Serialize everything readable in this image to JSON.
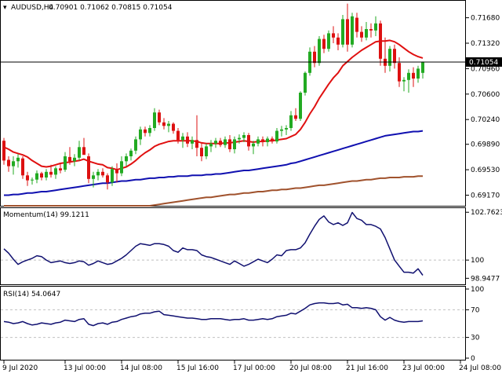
{
  "header": {
    "main_title": "AUDUSD,H4",
    "ohlc": "0.70901 0.71062 0.70815 0.71054",
    "momentum_title": "Momentum(14) 99.1211",
    "rsi_title": "RSI(14) 54.0647"
  },
  "colors": {
    "bull": "#22aa22",
    "bear": "#dd1111",
    "ma_fast": "#e01010",
    "ma_mid": "#1010b0",
    "ma_slow": "#a0522d",
    "oscillator": "#101070",
    "grid": "#c0c0c0",
    "current_price_bg": "#000000"
  },
  "chart_data": [
    {
      "type": "candlestick",
      "title": "AUDUSD,H4",
      "ylim": [
        0.6902,
        0.7192
      ],
      "y_ticks": [
        "0.71680",
        "0.71320",
        "0.70960",
        "0.70600",
        "0.70240",
        "0.69890",
        "0.69530",
        "0.69170"
      ],
      "y_tick_values": [
        0.7168,
        0.7132,
        0.7096,
        0.706,
        0.7024,
        0.6989,
        0.6953,
        0.6917
      ],
      "current_price": "0.71054",
      "current_price_value": 0.71054,
      "x_ticks": [
        "9 Jul 2020",
        "13 Jul 00:00",
        "14 Jul 08:00",
        "15 Jul 16:00",
        "17 Jul 00:00",
        "20 Jul 08:00",
        "21 Jul 16:00",
        "23 Jul 00:00",
        "24 Jul 08:00"
      ],
      "x_tick_bars": [
        0,
        13,
        25,
        37,
        49,
        61,
        73,
        85,
        97
      ],
      "candles": [
        [
          0.6994,
          0.6998,
          0.696,
          0.6966
        ],
        [
          0.6967,
          0.6972,
          0.695,
          0.6958
        ],
        [
          0.6958,
          0.6972,
          0.6946,
          0.6965
        ],
        [
          0.6965,
          0.6975,
          0.6956,
          0.697
        ],
        [
          0.6969,
          0.6972,
          0.694,
          0.6945
        ],
        [
          0.6945,
          0.695,
          0.693,
          0.6938
        ],
        [
          0.6938,
          0.6942,
          0.6932,
          0.6939
        ],
        [
          0.6939,
          0.6952,
          0.6934,
          0.6948
        ],
        [
          0.6948,
          0.695,
          0.6938,
          0.6942
        ],
        [
          0.6942,
          0.6954,
          0.6938,
          0.695
        ],
        [
          0.695,
          0.696,
          0.6942,
          0.6946
        ],
        [
          0.6946,
          0.6958,
          0.694,
          0.6955
        ],
        [
          0.6955,
          0.6962,
          0.6948,
          0.6952
        ],
        [
          0.6953,
          0.6978,
          0.695,
          0.6972
        ],
        [
          0.6971,
          0.6985,
          0.696,
          0.6965
        ],
        [
          0.6965,
          0.6975,
          0.6958,
          0.697
        ],
        [
          0.697,
          0.6994,
          0.6966,
          0.6985
        ],
        [
          0.6985,
          0.6998,
          0.6978,
          0.6974
        ],
        [
          0.6972,
          0.6976,
          0.6934,
          0.694
        ],
        [
          0.694,
          0.695,
          0.6928,
          0.6945
        ],
        [
          0.6945,
          0.6954,
          0.6938,
          0.695
        ],
        [
          0.695,
          0.6955,
          0.6942,
          0.6945
        ],
        [
          0.6945,
          0.6948,
          0.6925,
          0.6935
        ],
        [
          0.6935,
          0.6958,
          0.693,
          0.6954
        ],
        [
          0.6954,
          0.6962,
          0.6935,
          0.6948
        ],
        [
          0.6948,
          0.6972,
          0.6944,
          0.6965
        ],
        [
          0.6965,
          0.6976,
          0.6958,
          0.6972
        ],
        [
          0.6972,
          0.6983,
          0.6966,
          0.698
        ],
        [
          0.698,
          0.7,
          0.6975,
          0.6996
        ],
        [
          0.6996,
          0.7014,
          0.6988,
          0.701
        ],
        [
          0.701,
          0.7014,
          0.7,
          0.7005
        ],
        [
          0.7005,
          0.7016,
          0.7,
          0.7012
        ],
        [
          0.7012,
          0.704,
          0.7008,
          0.7034
        ],
        [
          0.7034,
          0.7038,
          0.7016,
          0.702
        ],
        [
          0.702,
          0.7026,
          0.701,
          0.7015
        ],
        [
          0.7015,
          0.7022,
          0.7006,
          0.7018
        ],
        [
          0.7018,
          0.702,
          0.7004,
          0.7008
        ],
        [
          0.7008,
          0.7012,
          0.699,
          0.6995
        ],
        [
          0.6995,
          0.7005,
          0.6984,
          0.7
        ],
        [
          0.7,
          0.7006,
          0.6985,
          0.699
        ],
        [
          0.699,
          0.7,
          0.6982,
          0.6995
        ],
        [
          0.6995,
          0.703,
          0.6972,
          0.6984
        ],
        [
          0.6984,
          0.699,
          0.6965,
          0.6972
        ],
        [
          0.6972,
          0.699,
          0.6968,
          0.6986
        ],
        [
          0.6986,
          0.6995,
          0.6978,
          0.699
        ],
        [
          0.699,
          0.6998,
          0.6984,
          0.6994
        ],
        [
          0.6994,
          0.6998,
          0.6985,
          0.6988
        ],
        [
          0.6988,
          0.7,
          0.6984,
          0.6996
        ],
        [
          0.6996,
          0.7002,
          0.6978,
          0.6982
        ],
        [
          0.6982,
          0.7,
          0.6976,
          0.6996
        ],
        [
          0.6996,
          0.7003,
          0.699,
          0.6998
        ],
        [
          0.6998,
          0.7006,
          0.6992,
          0.7002
        ],
        [
          0.7002,
          0.7005,
          0.698,
          0.6986
        ],
        [
          0.6986,
          0.6994,
          0.6975,
          0.699
        ],
        [
          0.699,
          0.7,
          0.6986,
          0.6996
        ],
        [
          0.6996,
          0.7,
          0.6986,
          0.6992
        ],
        [
          0.6992,
          0.7,
          0.6986,
          0.6997
        ],
        [
          0.6997,
          0.7,
          0.699,
          0.6993
        ],
        [
          0.6993,
          0.7012,
          0.699,
          0.7008
        ],
        [
          0.7008,
          0.7015,
          0.7,
          0.701
        ],
        [
          0.701,
          0.7016,
          0.7002,
          0.7012
        ],
        [
          0.7012,
          0.7036,
          0.7008,
          0.703
        ],
        [
          0.703,
          0.704,
          0.7022,
          0.7025
        ],
        [
          0.7025,
          0.7064,
          0.7022,
          0.7062
        ],
        [
          0.7062,
          0.7092,
          0.7058,
          0.709
        ],
        [
          0.709,
          0.7126,
          0.7086,
          0.712
        ],
        [
          0.712,
          0.7128,
          0.7098,
          0.7104
        ],
        [
          0.7104,
          0.7142,
          0.71,
          0.7138
        ],
        [
          0.7138,
          0.7144,
          0.7118,
          0.7124
        ],
        [
          0.7124,
          0.715,
          0.712,
          0.7146
        ],
        [
          0.7146,
          0.7156,
          0.7132,
          0.714
        ],
        [
          0.714,
          0.7146,
          0.7122,
          0.713
        ],
        [
          0.713,
          0.7172,
          0.7126,
          0.7166
        ],
        [
          0.7166,
          0.7188,
          0.712,
          0.713
        ],
        [
          0.713,
          0.7175,
          0.7126,
          0.717
        ],
        [
          0.7168,
          0.7175,
          0.714,
          0.7148
        ],
        [
          0.7148,
          0.7156,
          0.7134,
          0.714
        ],
        [
          0.714,
          0.7162,
          0.7136,
          0.7152
        ],
        [
          0.7152,
          0.716,
          0.714,
          0.715
        ],
        [
          0.715,
          0.717,
          0.7142,
          0.716
        ],
        [
          0.716,
          0.7164,
          0.71,
          0.711
        ],
        [
          0.711,
          0.714,
          0.709,
          0.71
        ],
        [
          0.71,
          0.7128,
          0.7092,
          0.7124
        ],
        [
          0.7124,
          0.713,
          0.7096,
          0.7104
        ],
        [
          0.7104,
          0.7112,
          0.707,
          0.7078
        ],
        [
          0.7078,
          0.7084,
          0.7064,
          0.708
        ],
        [
          0.708,
          0.7095,
          0.7062,
          0.709
        ],
        [
          0.709,
          0.7098,
          0.707,
          0.7082
        ],
        [
          0.7082,
          0.71,
          0.7076,
          0.7096
        ],
        [
          0.709,
          0.7106,
          0.7082,
          0.7105
        ]
      ],
      "series": [
        {
          "values": [
            0.6985,
            0.6982,
            0.6978,
            0.6976,
            0.6974,
            0.6971,
            0.6966,
            0.6962,
            0.6958,
            0.6957,
            0.6958,
            0.696,
            0.6962,
            0.6963,
            0.6964,
            0.6965,
            0.6966,
            0.6968,
            0.6965,
            0.6963,
            0.6961,
            0.696,
            0.6956,
            0.6955,
            0.6953,
            0.6955,
            0.6957,
            0.6961,
            0.6966,
            0.6972,
            0.6977,
            0.6981,
            0.6986,
            0.6989,
            0.6991,
            0.6993,
            0.6994,
            0.6994,
            0.6994,
            0.6994,
            0.6994,
            0.6993,
            0.6991,
            0.699,
            0.699,
            0.699,
            0.699,
            0.6991,
            0.6991,
            0.6992,
            0.6993,
            0.6994,
            0.6993,
            0.6992,
            0.6993,
            0.6993,
            0.6994,
            0.6994,
            0.6995,
            0.6996,
            0.6997,
            0.7,
            0.7003,
            0.701,
            0.702,
            0.7032,
            0.7042,
            0.7054,
            0.7064,
            0.7074,
            0.7083,
            0.709,
            0.71,
            0.7106,
            0.7112,
            0.7117,
            0.7122,
            0.7126,
            0.713,
            0.7134,
            0.7135,
            0.7135,
            0.7136,
            0.7134,
            0.713,
            0.7125,
            0.712,
            0.7116,
            0.7113,
            0.7111
          ]
        },
        {
          "values": [
            0.6917,
            0.6917,
            0.6918,
            0.6918,
            0.6919,
            0.692,
            0.692,
            0.6921,
            0.6922,
            0.6922,
            0.6923,
            0.6924,
            0.6925,
            0.6926,
            0.6927,
            0.6928,
            0.6929,
            0.693,
            0.6931,
            0.6932,
            0.6933,
            0.6934,
            0.6934,
            0.6935,
            0.6936,
            0.6937,
            0.6937,
            0.6938,
            0.6939,
            0.6939,
            0.694,
            0.6941,
            0.6941,
            0.6942,
            0.6942,
            0.6943,
            0.6943,
            0.6944,
            0.6944,
            0.6944,
            0.6945,
            0.6945,
            0.6945,
            0.6946,
            0.6946,
            0.6947,
            0.6947,
            0.6948,
            0.6949,
            0.695,
            0.6951,
            0.6952,
            0.6952,
            0.6953,
            0.6954,
            0.6955,
            0.6956,
            0.6957,
            0.6958,
            0.6959,
            0.696,
            0.6962,
            0.6963,
            0.6965,
            0.6967,
            0.6969,
            0.6971,
            0.6973,
            0.6975,
            0.6977,
            0.6979,
            0.6981,
            0.6983,
            0.6985,
            0.6987,
            0.6989,
            0.6991,
            0.6993,
            0.6995,
            0.6997,
            0.6999,
            0.7001,
            0.7002,
            0.7003,
            0.7004,
            0.7005,
            0.7006,
            0.7007,
            0.7007,
            0.7008
          ]
        },
        {
          "values": [
            0.6902,
            0.6902,
            0.6902,
            0.6902,
            0.6902,
            0.6902,
            0.6902,
            0.6902,
            0.6902,
            0.6902,
            0.6902,
            0.6902,
            0.6902,
            0.6902,
            0.6902,
            0.6902,
            0.6902,
            0.6902,
            0.6902,
            0.6902,
            0.6902,
            0.6902,
            0.6902,
            0.6902,
            0.6902,
            0.6902,
            0.6902,
            0.6902,
            0.6902,
            0.6902,
            0.6902,
            0.6902,
            0.6903,
            0.6904,
            0.6905,
            0.6906,
            0.6907,
            0.6908,
            0.6909,
            0.691,
            0.6911,
            0.6912,
            0.6913,
            0.6914,
            0.6914,
            0.6915,
            0.6916,
            0.6917,
            0.6918,
            0.6918,
            0.6919,
            0.692,
            0.692,
            0.6921,
            0.6922,
            0.6922,
            0.6923,
            0.6924,
            0.6924,
            0.6925,
            0.6925,
            0.6926,
            0.6927,
            0.6927,
            0.6928,
            0.6929,
            0.693,
            0.6931,
            0.6931,
            0.6932,
            0.6933,
            0.6934,
            0.6935,
            0.6936,
            0.6937,
            0.6937,
            0.6938,
            0.6939,
            0.6939,
            0.694,
            0.6941,
            0.6941,
            0.6942,
            0.6942,
            0.6942,
            0.6943,
            0.6943,
            0.6943,
            0.6944,
            0.6944
          ]
        }
      ]
    },
    {
      "type": "line",
      "title": "Momentum(14) 99.1211",
      "ylim": [
        98.6,
        103.0
      ],
      "y_ticks": [
        "102.7623",
        "100",
        "98.9477"
      ],
      "y_tick_values": [
        102.7623,
        100.0,
        98.9477
      ],
      "reference_level": 100.0,
      "series": [
        {
          "values": [
            100.65,
            100.4,
            100.05,
            99.75,
            99.9,
            100.0,
            100.1,
            100.25,
            100.2,
            100.0,
            99.85,
            99.9,
            99.95,
            99.85,
            99.8,
            99.85,
            99.95,
            99.9,
            99.7,
            99.8,
            99.95,
            99.85,
            99.75,
            99.8,
            99.95,
            100.1,
            100.3,
            100.55,
            100.8,
            100.95,
            100.9,
            100.85,
            100.95,
            100.95,
            100.9,
            100.8,
            100.55,
            100.45,
            100.7,
            100.6,
            100.6,
            100.55,
            100.3,
            100.2,
            100.15,
            100.05,
            99.95,
            99.85,
            99.75,
            99.95,
            99.8,
            99.65,
            99.75,
            99.9,
            100.05,
            99.95,
            99.85,
            100.05,
            100.3,
            100.25,
            100.55,
            100.6,
            100.6,
            100.7,
            101.0,
            101.5,
            101.95,
            102.35,
            102.55,
            102.2,
            102.05,
            102.15,
            102.0,
            102.15,
            102.75,
            102.4,
            102.3,
            102.05,
            102.05,
            101.95,
            101.8,
            101.3,
            100.65,
            100.0,
            99.65,
            99.3,
            99.3,
            99.25,
            99.5,
            99.12
          ]
        }
      ]
    },
    {
      "type": "line",
      "title": "RSI(14) 54.0647",
      "ylim": [
        0,
        100
      ],
      "y_ticks": [
        "100",
        "70",
        "30",
        "0"
      ],
      "y_tick_values": [
        100,
        70,
        30,
        0
      ],
      "reference_levels": [
        70,
        30
      ],
      "series": [
        {
          "values": [
            53,
            52,
            50,
            51,
            53,
            50,
            48,
            49,
            51,
            50,
            49,
            51,
            52,
            55,
            54,
            53,
            56,
            57,
            49,
            47,
            50,
            51,
            49,
            52,
            53,
            56,
            58,
            60,
            61,
            64,
            65,
            65,
            67,
            68,
            63,
            62,
            61,
            60,
            59,
            58,
            58,
            57,
            56,
            56,
            57,
            57,
            57,
            56,
            55,
            56,
            56,
            57,
            55,
            55,
            56,
            57,
            56,
            57,
            60,
            61,
            62,
            65,
            64,
            68,
            72,
            77,
            79,
            80,
            80,
            79,
            79,
            80,
            77,
            78,
            73,
            73,
            72,
            73,
            72,
            70,
            60,
            55,
            59,
            55,
            53,
            52,
            53,
            53,
            53,
            54
          ]
        }
      ]
    }
  ]
}
